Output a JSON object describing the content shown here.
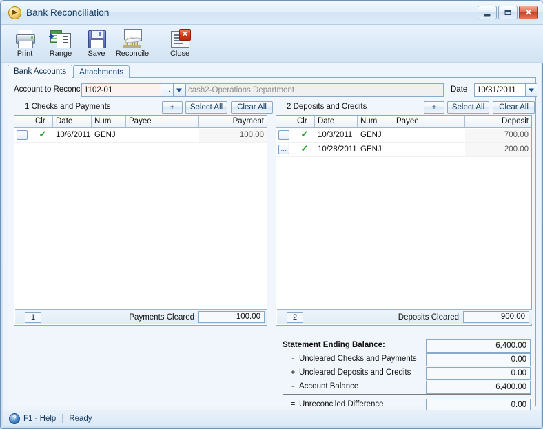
{
  "window": {
    "title": "Bank Reconciliation",
    "app_icon": "play-circle-icon",
    "controls": {
      "minimize": "minimize-icon",
      "maximize": "maximize-icon",
      "close": "✕"
    }
  },
  "toolbar": {
    "buttons": [
      {
        "label": "Print",
        "icon": "printer-icon"
      },
      {
        "label": "Range",
        "icon": "range-grid-icon"
      },
      {
        "label": "Save",
        "icon": "floppy-disk-icon"
      },
      {
        "label": "Reconcile",
        "icon": "bank-icon"
      },
      {
        "label": "Close",
        "icon": "close-document-icon"
      }
    ]
  },
  "tabs": [
    {
      "label": "Bank Accounts",
      "active": true
    },
    {
      "label": "Attachments",
      "active": false
    }
  ],
  "account": {
    "label": "Account to Reconcile",
    "code": "1102-01",
    "ellipsis_label": "...",
    "name": "cash2-Operations Department",
    "date_label": "Date",
    "date_value": "10/31/2011"
  },
  "left_section": {
    "title": "1  Checks and Payments",
    "add_label": "+",
    "select_all_label": "Select All",
    "clear_all_label": "Clear All",
    "columns": [
      "",
      "Clr",
      "Date",
      "Num",
      "Payee",
      "Payment"
    ],
    "rows": [
      {
        "btn": "...",
        "clr": "✓",
        "date": "10/6/2011",
        "num": "GENJ",
        "payee": "",
        "amount": "100.00"
      }
    ],
    "footer": {
      "count": "1",
      "label": "Payments Cleared",
      "value": "100.00"
    }
  },
  "right_section": {
    "title": "2  Deposits and Credits",
    "add_label": "+",
    "select_all_label": "Select All",
    "clear_all_label": "Clear All",
    "columns": [
      "",
      "Clr",
      "Date",
      "Num",
      "Payee",
      "Deposit"
    ],
    "rows": [
      {
        "btn": "...",
        "clr": "✓",
        "date": "10/3/2011",
        "num": "GENJ",
        "payee": "",
        "amount": "700.00"
      },
      {
        "btn": "...",
        "clr": "✓",
        "date": "10/28/2011",
        "num": "GENJ",
        "payee": "",
        "amount": "200.00"
      }
    ],
    "footer": {
      "count": "2",
      "label": "Deposits Cleared",
      "value": "900.00"
    }
  },
  "summary": {
    "rows": [
      {
        "op": "",
        "label": "Statement Ending Balance:",
        "value": "6,400.00",
        "bold": true
      },
      {
        "op": "-",
        "label": "Uncleared Checks and Payments",
        "value": "0.00",
        "bold": false
      },
      {
        "op": "+",
        "label": "Uncleared Deposits and Credits",
        "value": "0.00",
        "bold": false
      },
      {
        "op": "-",
        "label": "Account Balance",
        "value": "6,400.00",
        "bold": false
      },
      {
        "op": "=",
        "label": "Unreconciled Difference",
        "value": "0.00",
        "bold": false
      }
    ]
  },
  "statusbar": {
    "help_icon": "question-mark-icon",
    "help_text": "F1 - Help",
    "state_text": "Ready"
  },
  "colors": {
    "window_border": "#6f93b8",
    "title_text": "#14395e",
    "close_button": "#c64227",
    "check_green": "#13a015",
    "account_field_bg": "#fdf2f2",
    "readonly_field_bg": "#f0f0f0"
  }
}
